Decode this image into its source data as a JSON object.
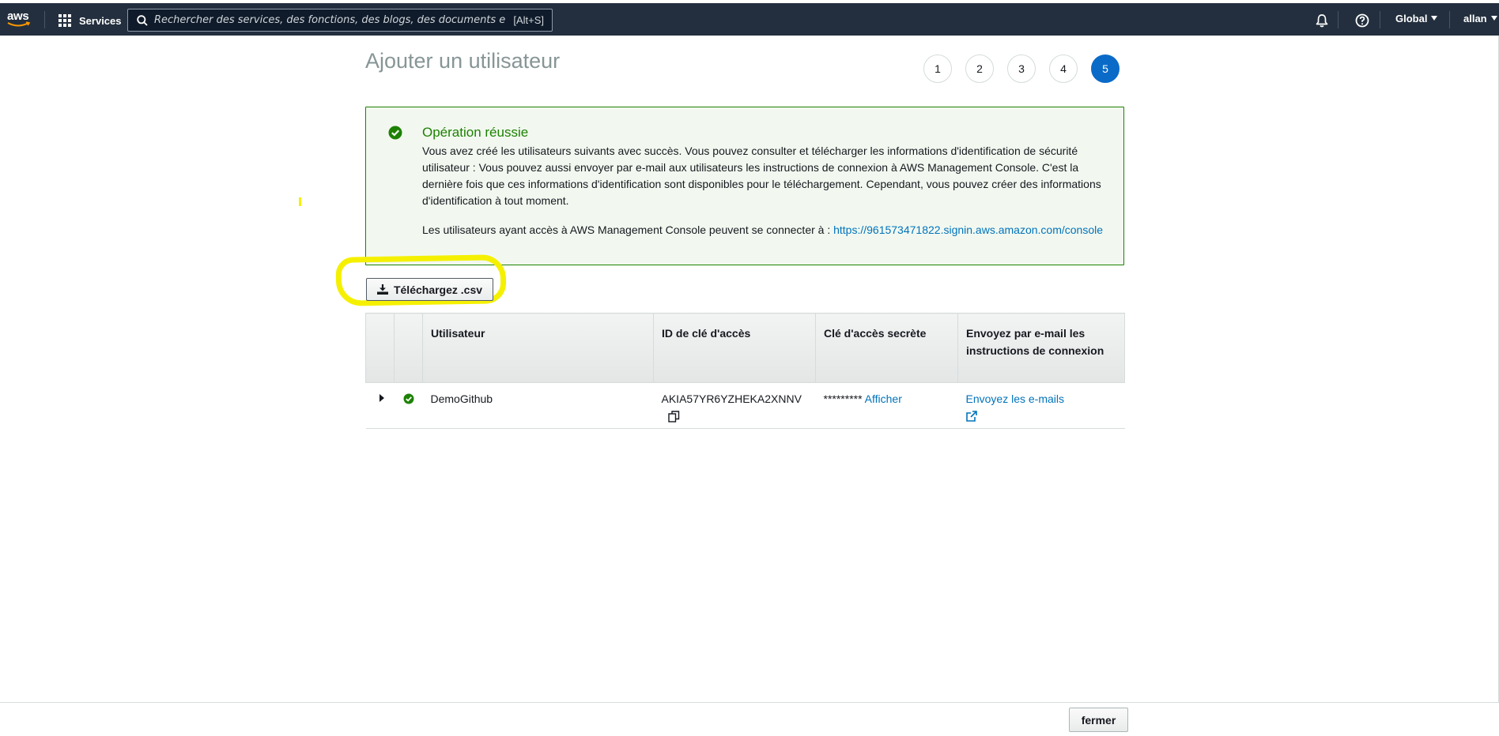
{
  "nav": {
    "logo_text": "aws",
    "services_label": "Services",
    "search_placeholder": "Rechercher des services, des fonctions, des blogs, des documents et plus",
    "search_shortcut": "[Alt+S]",
    "region_label": "Global",
    "user_label": "allan",
    "icons": [
      "grid-icon",
      "search-icon",
      "bell-icon",
      "help-icon"
    ]
  },
  "page": {
    "title": "Ajouter un utilisateur",
    "steps": [
      "1",
      "2",
      "3",
      "4",
      "5"
    ],
    "active_step": "5"
  },
  "success": {
    "title": "Opération réussie",
    "message": "Vous avez créé les utilisateurs suivants avec succès. Vous pouvez consulter et télécharger les informations d'identification de sécurité utilisateur : Vous pouvez aussi envoyer par e-mail aux utilisateurs les instructions de connexion à AWS Management Console. C'est la dernière fois que ces informations d'identification sont disponibles pour le téléchargement. Cependant, vous pouvez créer des informations d'identification à tout moment.",
    "console_text": "Les utilisateurs ayant accès à AWS Management Console peuvent se connecter à : ",
    "console_url": "https://961573471822.signin.aws.amazon.com/console"
  },
  "download_button": "Téléchargez .csv",
  "table": {
    "headers": {
      "user": "Utilisateur",
      "access_key_id": "ID de clé d'accès",
      "secret_key": "Clé d'accès secrète",
      "email": "Envoyez par e-mail les instructions de connexion"
    },
    "rows": [
      {
        "user": "DemoGithub",
        "access_key_id": "AKIA57YR6YZHEKA2XNNV",
        "secret_masked": "*********",
        "show_link": "Afficher",
        "email_link": "Envoyez les e-mails"
      }
    ]
  },
  "footer": {
    "close_button": "fermer"
  },
  "colors": {
    "nav_bg": "#232f3e",
    "success_green": "#1d8102",
    "success_bg": "#f2f8f0",
    "link_blue": "#0073bb",
    "active_step": "#0a6ac8",
    "highlight_yellow": "#f5f000"
  }
}
